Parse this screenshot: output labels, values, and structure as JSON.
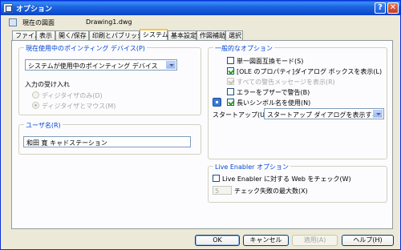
{
  "window": {
    "title": "オプション"
  },
  "profile": {
    "label": "現在の図面",
    "drawing": "Drawing1.dwg"
  },
  "tabs": [
    {
      "label": "ファイル"
    },
    {
      "label": "表示"
    },
    {
      "label": "開く/保存"
    },
    {
      "label": "印刷とパブリッシュ"
    },
    {
      "label": "システム"
    },
    {
      "label": "基本設定"
    },
    {
      "label": "作図補助"
    },
    {
      "label": "選択"
    }
  ],
  "pointing": {
    "legend": "現在使用中のポインティング デバイス(P)",
    "selected": "システムが使用中のポインティング デバイス",
    "input_label": "入力の受け入れ",
    "radio1": "ディジタイザのみ(D)",
    "radio2": "ディジタイザとマウス(M)"
  },
  "user": {
    "legend": "ユーザ名(R)",
    "value": "和田 寛 キャドステーション"
  },
  "general": {
    "legend": "一般的なオプション",
    "opt1": "単一図面互換モード(S)",
    "opt2": "[OLE のプロパティ]ダイアログ ボックスを表示(L)",
    "opt3": "すべての警告メッセージを表示(R)",
    "opt4": "エラーをブザーで警告(B)",
    "opt5": "長いシンボル名を使用(N)",
    "startup_label": "スタートアップ(U):",
    "startup_value": "スタートアップ ダイアログを表示する"
  },
  "live": {
    "legend": "Live Enabler オプション",
    "check": "Live Enabler に対する Web をチェック(W)",
    "count": "5",
    "count_label": "チェック失敗の最大数(X)"
  },
  "buttons": {
    "ok": "OK",
    "cancel": "キャンセル",
    "apply": "適用(A)",
    "help": "ヘルプ(H)"
  }
}
